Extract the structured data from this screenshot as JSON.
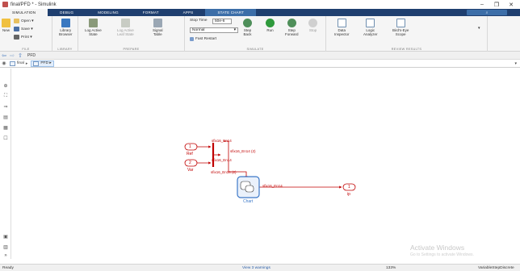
{
  "window": {
    "title": "final/PFD * - Simulink",
    "controls": [
      "–",
      "❐",
      "✕"
    ]
  },
  "tabs": [
    "SIMULATION",
    "DEBUG",
    "MODELING",
    "FORMAT",
    "APPS",
    "STATE CHART"
  ],
  "ribbon": {
    "file": {
      "label": "FILE",
      "new": "New",
      "open": "Open",
      "save": "Save",
      "print": "Print"
    },
    "library": {
      "label": "LIBRARY",
      "library_browser": "Library\nBrowser"
    },
    "prepare": {
      "label": "PREPARE",
      "log_active_state": "Log Active\nState",
      "log_active_leaf_state": "Log Active\nLeaf State",
      "signal_table": "Signal\nTable"
    },
    "simulate": {
      "label": "SIMULATE",
      "stop_time_label": "Stop Time",
      "stop_time_value": "50e-6",
      "mode": "Normal",
      "fast_restart": "Fast Restart",
      "step_back": "Step\nBack",
      "run": "Run",
      "step_forward": "Step\nForward",
      "stop": "Stop"
    },
    "review": {
      "label": "REVIEW RESULTS",
      "data_inspector": "Data\nInspector",
      "logic_analyzer": "Logic\nAnalyzer",
      "birds_eye_scope": "Bird's-Eye\nScope"
    }
  },
  "nav": {
    "model_label": "PFD"
  },
  "breadcrumb": [
    "final",
    "PFD"
  ],
  "diagram": {
    "inport1": {
      "number": "1",
      "label": "Ref"
    },
    "inport2": {
      "number": "2",
      "label": "Var"
    },
    "outport1": {
      "number": "1",
      "label": "ip"
    },
    "chart_label": "Chart",
    "signal_top": "sfix16_En14",
    "signal_bus": "sfix16_En14 (2)",
    "signal_bottom": "sfix16_En14",
    "signal_into_chart": "sfix16_En14 (2)",
    "signal_out": "sfix16_En14"
  },
  "watermark": {
    "line1": "Activate Windows",
    "line2": "Go to Settings to activate Windows."
  },
  "status": {
    "left": "Ready",
    "warnings": "View 3 warnings",
    "zoom": "133%",
    "solver": "VariableStepDiscrete"
  },
  "colors": {
    "tab_bar": "#1f3f6f",
    "block_red": "#c00000",
    "chart_blue": "#3c78c8"
  }
}
